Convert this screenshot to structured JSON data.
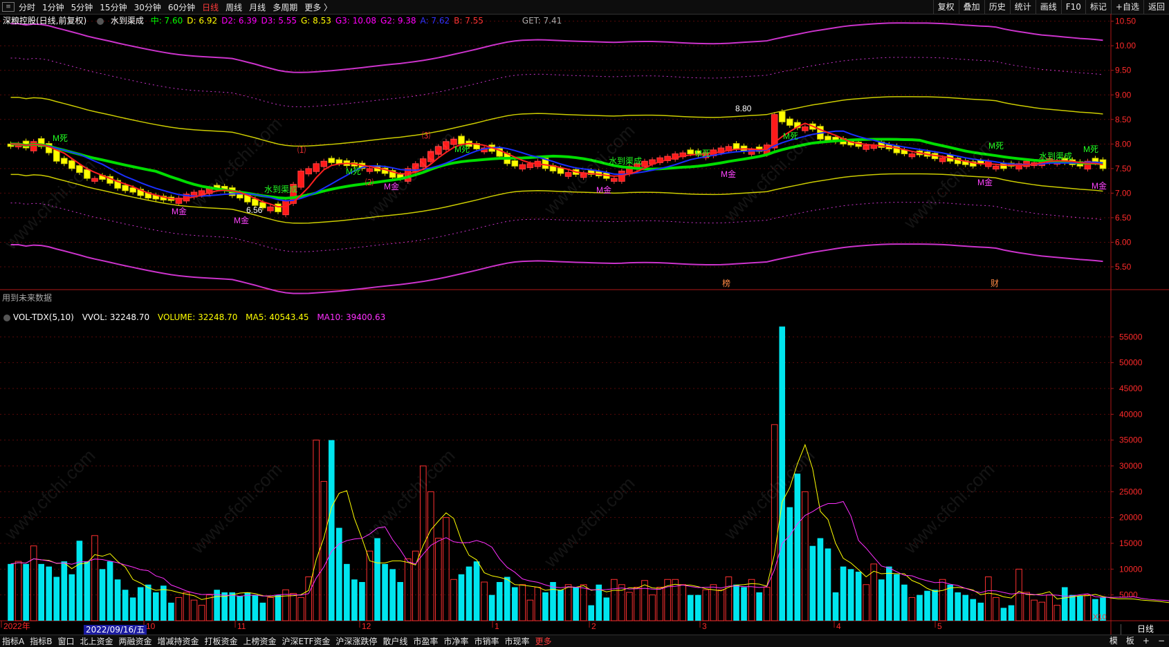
{
  "toolbar": {
    "timeframes": [
      "分时",
      "1分钟",
      "5分钟",
      "15分钟",
      "30分钟",
      "60分钟",
      "日线",
      "周线",
      "月线",
      "多周期",
      "更多 〉"
    ],
    "active": "日线",
    "right_tools": [
      "复权",
      "叠加",
      "历史",
      "统计",
      "画线",
      "F10",
      "标记",
      "+自选",
      "返回"
    ]
  },
  "info": {
    "stock": "深粮控股(日线,前复权)",
    "indicator": "水到渠成",
    "params": [
      {
        "t": "中: 7.60",
        "c": "#00ff00"
      },
      {
        "t": "D: 6.92",
        "c": "#ffff00"
      },
      {
        "t": "D2: 6.39",
        "c": "#ff00ff"
      },
      {
        "t": "D3: 5.55",
        "c": "#ff00ff"
      },
      {
        "t": "G: 8.53",
        "c": "#ffff00"
      },
      {
        "t": "G3: 10.08",
        "c": "#ff00ff"
      },
      {
        "t": "G2: 9.38",
        "c": "#ff00ff"
      },
      {
        "t": "A: 7.62",
        "c": "#3333ff"
      },
      {
        "t": "B: 7.55",
        "c": "#ff3333"
      }
    ],
    "get": "GET: 7.41"
  },
  "vol_info": {
    "name": "VOL-TDX(5,10)",
    "vvol": "VVOL: 32248.70",
    "volume": "VOLUME: 32248.70",
    "ma5": "MA5: 40543.45",
    "ma10": "MA10: 39400.63"
  },
  "future_note": "用到未来数据",
  "price_axis": [
    "10.50",
    "10.00",
    "9.50",
    "9.00",
    "8.50",
    "8.00",
    "7.50",
    "7.00",
    "6.50",
    "6.00",
    "5.50"
  ],
  "vol_axis": [
    "55000",
    "50000",
    "45000",
    "40000",
    "35000",
    "30000",
    "25000",
    "20000",
    "15000",
    "10000",
    "5000"
  ],
  "x_labels": [
    "2022年",
    "10",
    "11",
    "12",
    "1",
    "2",
    "3",
    "4",
    "5"
  ],
  "highlight_date": "2022/09/16/五",
  "period": "日线",
  "x10": "X10",
  "annotations": {
    "high": "8.80",
    "low": "6.56",
    "mdeath": "M死",
    "mgold": "M金",
    "shui": "水到渠成",
    "bang": "榜",
    "cai": "财",
    "n1": "⑴",
    "n2": "⑵",
    "n3": "⑶"
  },
  "watermark": "www.cfchi.com",
  "colors": {
    "up": "#ff2020",
    "down": "#00e5ee",
    "mid": "#00dd00",
    "a": "#1a30ff",
    "g": "#e8e800",
    "d2": "#ff30ff"
  },
  "bottom": {
    "items": [
      "指标A",
      "指标B",
      "窗口",
      "北上资金",
      "两融资金",
      "增减持资金",
      "打板资金",
      "上榜资金",
      "沪深ETF资金",
      "沪深涨跌停",
      "散户线",
      "市盈率",
      "市净率",
      "市销率",
      "市现率",
      "更多"
    ],
    "right": [
      "模",
      "板",
      "+",
      "−"
    ]
  },
  "chart_data": {
    "type": "candlestick_volume",
    "price_range": [
      5.05,
      10.65
    ],
    "volume_range": [
      0,
      60000
    ],
    "closes": [
      8.0,
      8.0,
      7.92,
      8.05,
      7.95,
      7.82,
      7.65,
      7.6,
      7.5,
      7.42,
      7.3,
      7.3,
      7.28,
      7.2,
      7.1,
      7.05,
      7.02,
      6.95,
      6.9,
      6.88,
      6.86,
      6.85,
      6.9,
      6.98,
      7.02,
      7.05,
      7.1,
      7.08,
      7.05,
      6.95,
      6.9,
      6.82,
      6.75,
      6.7,
      6.72,
      6.62,
      6.85,
      7.18,
      7.45,
      7.5,
      7.6,
      7.65,
      7.62,
      7.6,
      7.56,
      7.55,
      7.5,
      7.5,
      7.45,
      7.4,
      7.32,
      7.3,
      7.5,
      7.6,
      7.7,
      7.85,
      7.95,
      8.05,
      8.1,
      8.0,
      7.95,
      7.9,
      7.92,
      7.85,
      7.75,
      7.6,
      7.55,
      7.58,
      7.6,
      7.65,
      7.5,
      7.45,
      7.4,
      7.42,
      7.38,
      7.4,
      7.38,
      7.35,
      7.3,
      7.3,
      7.45,
      7.55,
      7.6,
      7.65,
      7.68,
      7.72,
      7.75,
      7.8,
      7.82,
      7.8,
      7.78,
      7.82,
      7.88,
      7.92,
      7.95,
      7.9,
      7.85,
      7.88,
      7.85,
      7.98,
      8.6,
      8.45,
      8.38,
      8.33,
      8.35,
      8.3,
      8.1,
      8.08,
      8.05,
      8.0,
      7.98,
      7.95,
      7.97,
      7.98,
      7.93,
      7.9,
      7.82,
      7.8,
      7.8,
      7.78,
      7.75,
      7.7,
      7.72,
      7.65,
      7.6,
      7.58,
      7.55,
      7.6,
      7.65,
      7.55,
      7.5,
      7.55,
      7.6,
      7.65,
      7.62,
      7.68,
      7.7,
      7.65,
      7.62,
      7.58,
      7.55,
      7.65,
      7.62,
      7.5
    ],
    "up": [
      0,
      1,
      0,
      1,
      0,
      0,
      0,
      0,
      0,
      0,
      0,
      1,
      0,
      0,
      0,
      0,
      0,
      0,
      0,
      0,
      0,
      0,
      1,
      1,
      1,
      1,
      1,
      0,
      0,
      0,
      0,
      0,
      0,
      0,
      1,
      0,
      1,
      1,
      1,
      1,
      1,
      1,
      0,
      0,
      0,
      0,
      0,
      1,
      0,
      0,
      0,
      0,
      1,
      1,
      1,
      1,
      1,
      1,
      1,
      0,
      0,
      0,
      1,
      0,
      0,
      0,
      0,
      1,
      1,
      1,
      0,
      0,
      0,
      1,
      0,
      1,
      0,
      0,
      0,
      1,
      1,
      1,
      1,
      1,
      1,
      1,
      1,
      1,
      1,
      0,
      0,
      1,
      1,
      1,
      1,
      0,
      0,
      1,
      0,
      1,
      1,
      0,
      0,
      0,
      1,
      0,
      0,
      0,
      0,
      0,
      0,
      0,
      1,
      1,
      0,
      0,
      0,
      0,
      1,
      0,
      0,
      0,
      1,
      0,
      0,
      0,
      0,
      0,
      1,
      1,
      0,
      0,
      1,
      1,
      1,
      1,
      1,
      1,
      0,
      0,
      0,
      1,
      0,
      0
    ],
    "volumes": [
      11000,
      11500,
      11000,
      14500,
      11000,
      10500,
      8500,
      11500,
      9000,
      15500,
      11500,
      16500,
      10000,
      11500,
      8000,
      6000,
      4500,
      6500,
      7000,
      5500,
      6800,
      3500,
      4500,
      5500,
      4000,
      3000,
      5000,
      6000,
      5500,
      5500,
      4800,
      5500,
      5000,
      3500,
      4500,
      5000,
      6000,
      5300,
      4500,
      8500,
      35000,
      27000,
      35000,
      18000,
      11000,
      8000,
      7500,
      13500,
      16000,
      11000,
      10000,
      7500,
      12000,
      13500,
      30000,
      25000,
      16000,
      20000,
      8000,
      9000,
      10500,
      11500,
      7500,
      5000,
      7500,
      8500,
      6500,
      7000,
      4000,
      6500,
      5500,
      7500,
      6000,
      7000,
      6500,
      7000,
      3000,
      7000,
      4500,
      8000,
      7000,
      5500,
      6500,
      7800,
      5000,
      6500,
      8000,
      8000,
      7000,
      5000,
      5000,
      6000,
      7000,
      6000,
      8500,
      7000,
      6500,
      8000,
      5500,
      6500,
      38000,
      57000,
      22000,
      28500,
      25000,
      14500,
      16000,
      14000,
      5500,
      10500,
      10000,
      9500,
      7000,
      11000,
      8000,
      10500,
      9000,
      7000,
      4500,
      5000,
      5800,
      6000,
      8000,
      7000,
      5500,
      5000,
      4200,
      3500,
      8500,
      4500,
      2500,
      3000,
      10000,
      5500,
      4000,
      3600,
      5000,
      3000,
      6500,
      5000,
      4800,
      5000,
      4200,
      4500,
      3600,
      4000,
      5000,
      4000,
      3500,
      3000,
      3500,
      4200,
      3000
    ]
  }
}
